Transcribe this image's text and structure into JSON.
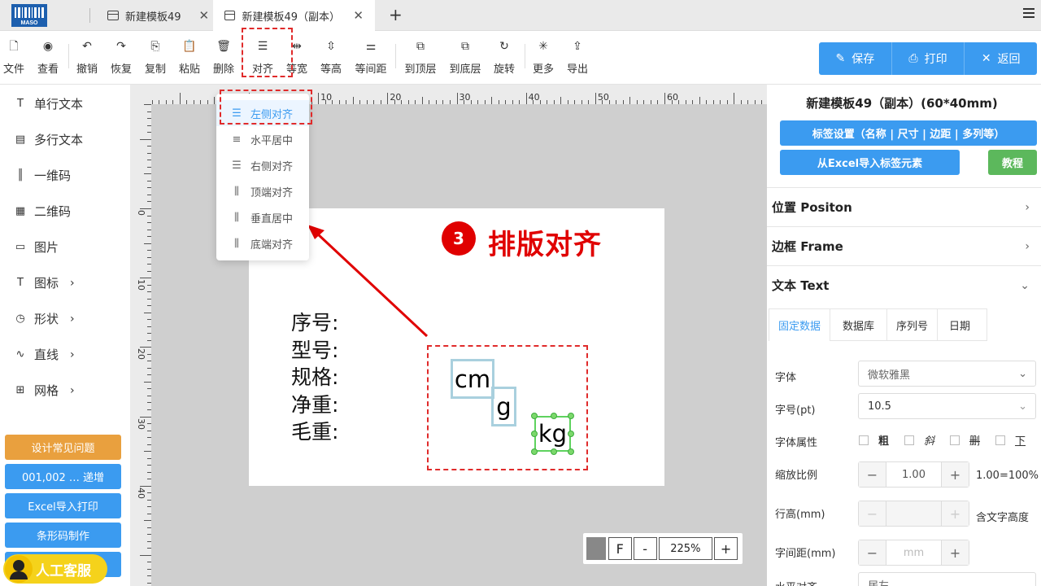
{
  "tabs": [
    {
      "title": "新建模板49",
      "close": "✕"
    },
    {
      "title": "新建模板49（副本）",
      "close": "✕"
    }
  ],
  "add_tab": "+",
  "logo_text": "MASO",
  "toolbar": [
    {
      "label": "文件",
      "icon": "file-icon"
    },
    {
      "label": "查看",
      "icon": "eye-icon"
    },
    {
      "label": "撤销",
      "icon": "undo-icon"
    },
    {
      "label": "恢复",
      "icon": "redo-icon"
    },
    {
      "label": "复制",
      "icon": "copy-icon"
    },
    {
      "label": "粘贴",
      "icon": "paste-icon"
    },
    {
      "label": "删除",
      "icon": "trash-icon"
    },
    {
      "label": "对齐",
      "icon": "align-icon"
    },
    {
      "label": "等宽",
      "icon": "same-width-icon"
    },
    {
      "label": "等高",
      "icon": "same-height-icon"
    },
    {
      "label": "等间距",
      "icon": "equal-spacing-icon"
    },
    {
      "label": "到顶层",
      "icon": "bring-front-icon"
    },
    {
      "label": "到底层",
      "icon": "send-back-icon"
    },
    {
      "label": "旋转",
      "icon": "rotate-icon"
    },
    {
      "label": "更多",
      "icon": "more-icon"
    },
    {
      "label": "导出",
      "icon": "export-icon"
    }
  ],
  "actions": {
    "save": "保存",
    "print": "打印",
    "back": "返回"
  },
  "sidebar": {
    "items": [
      {
        "label": "单行文本",
        "glyph": "T"
      },
      {
        "label": "多行文本",
        "glyph": "▤"
      },
      {
        "label": "一维码",
        "glyph": "║"
      },
      {
        "label": "二维码",
        "glyph": "▦"
      },
      {
        "label": "图片",
        "glyph": "▭"
      },
      {
        "label": "图标",
        "glyph": "T",
        "arrow": "›"
      },
      {
        "label": "形状",
        "glyph": "◷",
        "arrow": "›"
      },
      {
        "label": "直线",
        "glyph": "∿",
        "arrow": "›"
      },
      {
        "label": "网格",
        "glyph": "⊞",
        "arrow": "›"
      }
    ],
    "buttons": [
      "设计常见问题",
      "001,002 … 递增",
      "Excel导入打印",
      "条形码制作"
    ],
    "kefu": "人工客服"
  },
  "ruler": {
    "top": [
      "10",
      "20",
      "30",
      "40",
      "50",
      "60"
    ],
    "left": [
      "0",
      "10",
      "20",
      "30",
      "40"
    ]
  },
  "label_fields": [
    "序号:",
    "型号:",
    "规格:",
    "净重:",
    "毛重:"
  ],
  "elements": {
    "cm": "cm",
    "g": "g",
    "kg": "kg"
  },
  "annotation": {
    "number": "3",
    "text": "排版对齐"
  },
  "align_menu": [
    {
      "label": "左侧对齐",
      "glyph": "☰"
    },
    {
      "label": "水平居中",
      "glyph": "≡"
    },
    {
      "label": "右侧对齐",
      "glyph": "☰"
    },
    {
      "label": "顶端对齐",
      "glyph": "⫼"
    },
    {
      "label": "垂直居中",
      "glyph": "⫼"
    },
    {
      "label": "底端对齐",
      "glyph": "⫼"
    }
  ],
  "zoom": {
    "f": "F",
    "minus": "-",
    "value": "225%",
    "plus": "+"
  },
  "panel": {
    "title": "新建模板49（副本）(60*40mm)",
    "label_settings": "标签设置（名称 | 尺寸 | 边距 | 多列等）",
    "excel_import": "从Excel导入标签元素",
    "tutorial": "教程",
    "sections": [
      {
        "label": "位置 Positon",
        "chev": "›"
      },
      {
        "label": "边框 Frame",
        "chev": "›"
      },
      {
        "label": "文本 Text",
        "chev": "⌄"
      }
    ],
    "subtabs": [
      "固定数据",
      "数据库",
      "序列号",
      "日期"
    ],
    "font_label": "字体",
    "font_value": "微软雅黑",
    "size_label": "字号(pt)",
    "size_value": "10.5",
    "attr_label": "字体属性",
    "attrs": [
      "粗",
      "斜",
      "删",
      "下"
    ],
    "scale_label": "缩放比例",
    "scale_value": "1.00",
    "scale_note": "1.00=100%",
    "lineheight_label": "行高(mm)",
    "lineheight_note": "含文字高度",
    "spacing_label": "字间距(mm)",
    "spacing_placeholder": "mm",
    "halign_label": "水平对齐",
    "halign_value": "居左"
  },
  "colors": {
    "accent": "#3b9bf0",
    "annotation": "#e00000",
    "orange": "#e9a03e",
    "green": "#5cb85c"
  }
}
